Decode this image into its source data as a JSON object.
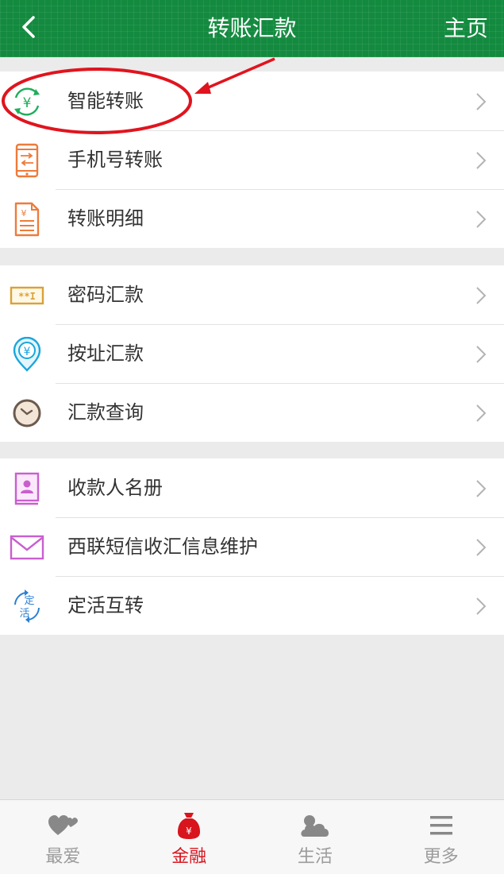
{
  "header": {
    "title": "转账汇款",
    "home_label": "主页"
  },
  "groups": [
    {
      "items": [
        {
          "label": "智能转账",
          "icon": "yuan-refresh-icon"
        },
        {
          "label": "手机号转账",
          "icon": "phone-transfer-icon"
        },
        {
          "label": "转账明细",
          "icon": "document-yuan-icon"
        }
      ]
    },
    {
      "items": [
        {
          "label": "密码汇款",
          "icon": "password-card-icon"
        },
        {
          "label": "按址汇款",
          "icon": "location-yuan-icon"
        },
        {
          "label": "汇款查询",
          "icon": "clock-icon"
        }
      ]
    },
    {
      "items": [
        {
          "label": "收款人名册",
          "icon": "contact-book-icon"
        },
        {
          "label": "西联短信收汇信息维护",
          "icon": "envelope-icon"
        },
        {
          "label": "定活互转",
          "icon": "fixed-current-swap-icon"
        }
      ]
    }
  ],
  "icon_texts": {
    "fixed": "定",
    "current": "活",
    "password": "**I"
  },
  "tabs": [
    {
      "label": "最爱",
      "icon": "hearts-icon",
      "active": false
    },
    {
      "label": "金融",
      "icon": "money-bag-icon",
      "active": true
    },
    {
      "label": "生活",
      "icon": "cloud-icon",
      "active": false
    },
    {
      "label": "更多",
      "icon": "menu-lines-icon",
      "active": false
    }
  ],
  "colors": {
    "header_bg": "#138a3f",
    "active_tab": "#d8141d",
    "annotation": "#e0141e"
  }
}
